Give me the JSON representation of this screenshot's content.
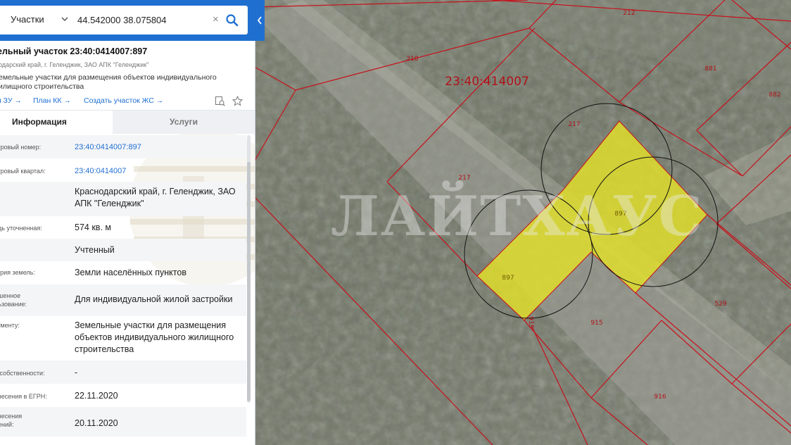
{
  "search": {
    "type_label": "Участки",
    "query": "44.542000 38.075804"
  },
  "card": {
    "title": "ельный участок 23:40:0414007:897",
    "address": "одарский край, г. Геленджик, ЗАО АПК \"Геленджик\"",
    "category_line1": "емельные участки для размещения объектов индивидуального",
    "category_line2": "илищного строительства",
    "links": [
      "я ЗУ →",
      "План КК →",
      "Создать участок ЖС →"
    ]
  },
  "tabs": {
    "info": "Информация",
    "services": "Услуги"
  },
  "rows": [
    {
      "label": "стровый номер:",
      "value": "23:40:0414007:897",
      "link": true
    },
    {
      "label": "стровый квартал:",
      "value": "23:40:0414007",
      "link": true
    },
    {
      "label": "с:",
      "value": "Краснодарский край, г. Геленджик, ЗАО АПК \"Геленджик\""
    },
    {
      "label": "адь уточненная:",
      "value": "574 кв. м"
    },
    {
      "label": "с:",
      "value": "Учтенный"
    },
    {
      "label": "гория земель:",
      "value": "Земли населённых пунктов"
    },
    {
      "label": "ешенное",
      "label2": "льзование:",
      "value": "Для индивидуальной жилой застройки"
    },
    {
      "label": "кументу:",
      "value": "Земельные участки для размещения объектов индивидуального жилищного строительства"
    },
    {
      "label": "а собственности:",
      "value": "-"
    },
    {
      "label": "внесения в ЕГРН:",
      "value": "22.11.2020"
    },
    {
      "label": "внесения",
      "label2": "нений:",
      "value": "20.11.2020"
    }
  ],
  "map": {
    "block_label": "23:40:414007",
    "plot_labels": [
      "212",
      "218",
      "881",
      "882",
      "217",
      "217",
      "897",
      "897",
      "915",
      "915",
      "529",
      "916"
    ],
    "watermark": "ЛАЙТХАУС",
    "colors": {
      "boundary": "#c8101a",
      "selected_fill": "#e3e02a",
      "accent": "#1f6fd1"
    }
  }
}
